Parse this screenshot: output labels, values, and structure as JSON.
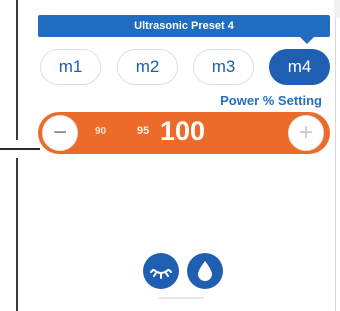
{
  "header": {
    "preset_title": "Ultrasonic Preset 4"
  },
  "modes": [
    {
      "label": "m1",
      "active": false
    },
    {
      "label": "m2",
      "active": false
    },
    {
      "label": "m3",
      "active": false
    },
    {
      "label": "m4",
      "active": true
    }
  ],
  "power": {
    "label": "Power % Setting",
    "minus_symbol": "−",
    "plus_symbol": "+",
    "prev_value_2": "90",
    "prev_value_1": "95",
    "current_value": "100"
  },
  "bottom": {
    "icons": [
      "light-icon",
      "water-drop-icon"
    ]
  },
  "colors": {
    "primary": "#1f5fb1",
    "accent": "#ec6a2a",
    "label_blue": "#2270c6"
  }
}
